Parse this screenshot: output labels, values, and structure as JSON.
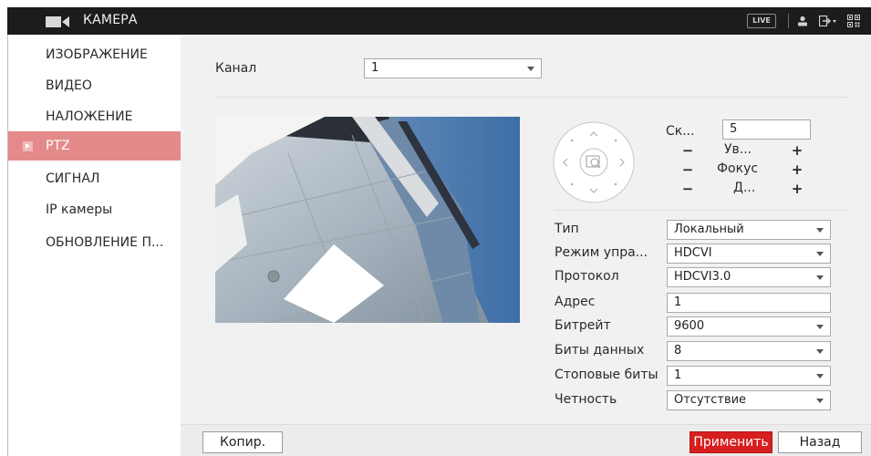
{
  "window": {
    "title": "КАМЕРА"
  },
  "topbar": {
    "live_label": "LIVE",
    "user_icon": "user-icon",
    "logout_icon": "logout-icon",
    "qr_icon": "qr-code-icon"
  },
  "sidebar": {
    "items": [
      {
        "label": "ИЗОБРАЖЕНИЕ",
        "active": false
      },
      {
        "label": "ВИДЕО",
        "active": false
      },
      {
        "label": "НАЛОЖЕНИЕ",
        "active": false
      },
      {
        "label": "PTZ",
        "active": true
      },
      {
        "label": "СИГНАЛ",
        "active": false
      },
      {
        "label": "IP камеры",
        "active": false
      },
      {
        "label": "ОБНОВЛЕНИЕ П...",
        "active": false
      }
    ]
  },
  "channel": {
    "label": "Канал",
    "value": "1"
  },
  "ptz_controls": {
    "speed_label": "Ск...",
    "speed_value": "5",
    "zoom_label": "Ув...",
    "focus_label": "Фокус",
    "iris_label": "Д...",
    "minus": "−",
    "plus": "+"
  },
  "settings": {
    "type": {
      "label": "Тип",
      "value": "Локальный"
    },
    "control_mode": {
      "label": "Режим упра...",
      "value": "HDCVI"
    },
    "protocol": {
      "label": "Протокол",
      "value": "HDCVI3.0"
    },
    "address": {
      "label": "Адрес",
      "value": "1"
    },
    "baudrate": {
      "label": "Битрейт",
      "value": "9600"
    },
    "data_bits": {
      "label": "Биты данных",
      "value": "8"
    },
    "stop_bits": {
      "label": "Стоповые биты",
      "value": "1"
    },
    "parity": {
      "label": "Четность",
      "value": "Отсутствие"
    }
  },
  "footer": {
    "copy_label": "Копир.",
    "apply_label": "Применить",
    "back_label": "Назад"
  },
  "colors": {
    "accent": "#d71f1f",
    "active_menu": "#e58a8a",
    "topbar": "#1c1c1c"
  }
}
